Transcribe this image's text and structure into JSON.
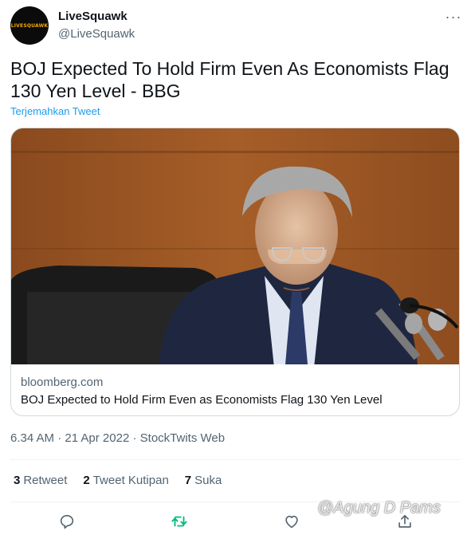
{
  "author": {
    "display_name": "LiveSquawk",
    "handle": "@LiveSquawk",
    "avatar_text": "LIVESQUAWK"
  },
  "menu": {
    "more_glyph": "···"
  },
  "tweet": {
    "text": "BOJ Expected To Hold Firm Even As Economists Flag 130 Yen Level - BBG",
    "translate_label": "Terjemahkan Tweet"
  },
  "card": {
    "domain": "bloomberg.com",
    "title": "BOJ Expected to Hold Firm Even as Economists Flag 130 Yen Level"
  },
  "meta": {
    "time": "6.34 AM",
    "date": "21 Apr 2022",
    "source": "StockTwits Web",
    "separator": " · "
  },
  "stats": [
    {
      "count": "3",
      "label": "Retweet"
    },
    {
      "count": "2",
      "label": "Tweet Kutipan"
    },
    {
      "count": "7",
      "label": "Suka"
    }
  ],
  "actions": [
    "reply-icon",
    "retweet-icon",
    "like-icon",
    "share-icon"
  ],
  "colors": {
    "accent": "#1d9bf0",
    "retweet": "#00ba7c",
    "secondary_text": "#536471"
  },
  "watermark": "@Agung D Pams"
}
